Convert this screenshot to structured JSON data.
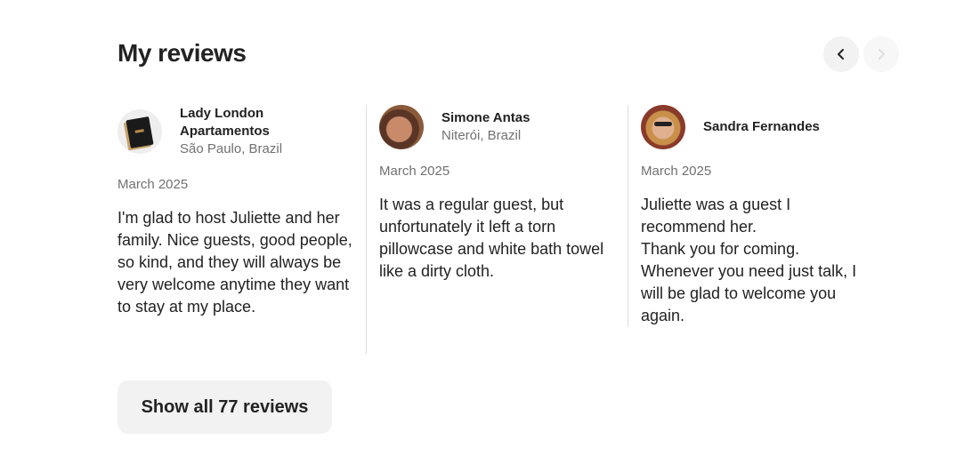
{
  "section": {
    "title": "My reviews",
    "show_all_label": "Show all 77 reviews"
  },
  "nav": {
    "prev_icon": "chevron-left-icon",
    "next_icon": "chevron-right-icon",
    "next_disabled": true
  },
  "reviews": [
    {
      "name": "Lady London Apartamentos",
      "location": "São Paulo, Brazil",
      "date": "March 2025",
      "text": "I'm glad to host Juliette and her family. Nice guests, good people, so kind, and they will always be very welcome anytime they want to stay at my place."
    },
    {
      "name": "Simone Antas",
      "location": "Niterói, Brazil",
      "date": "March 2025",
      "text": "It was a regular guest, but unfortunately it left a torn pillowcase and white bath towel like a dirty cloth."
    },
    {
      "name": "Sandra Fernandes",
      "location": "",
      "date": "March 2025",
      "text": "Juliette was a guest I recommend her.\nThank you for coming.\nWhenever you need just talk, I will be glad to welcome you again."
    }
  ]
}
